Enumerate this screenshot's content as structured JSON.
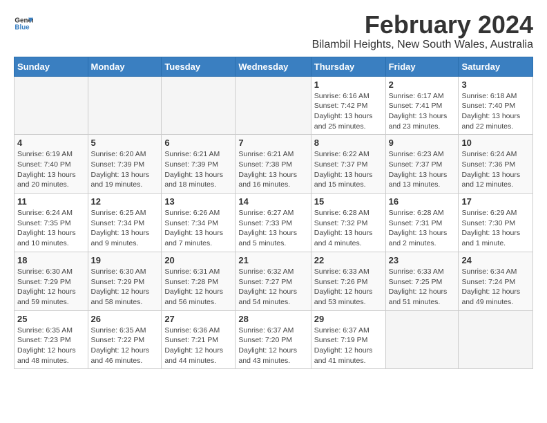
{
  "logo": {
    "text_general": "General",
    "text_blue": "Blue"
  },
  "title": "February 2024",
  "subtitle": "Bilambil Heights, New South Wales, Australia",
  "days_of_week": [
    "Sunday",
    "Monday",
    "Tuesday",
    "Wednesday",
    "Thursday",
    "Friday",
    "Saturday"
  ],
  "weeks": [
    [
      {
        "day": "",
        "info": ""
      },
      {
        "day": "",
        "info": ""
      },
      {
        "day": "",
        "info": ""
      },
      {
        "day": "",
        "info": ""
      },
      {
        "day": "1",
        "info": "Sunrise: 6:16 AM\nSunset: 7:42 PM\nDaylight: 13 hours\nand 25 minutes."
      },
      {
        "day": "2",
        "info": "Sunrise: 6:17 AM\nSunset: 7:41 PM\nDaylight: 13 hours\nand 23 minutes."
      },
      {
        "day": "3",
        "info": "Sunrise: 6:18 AM\nSunset: 7:40 PM\nDaylight: 13 hours\nand 22 minutes."
      }
    ],
    [
      {
        "day": "4",
        "info": "Sunrise: 6:19 AM\nSunset: 7:40 PM\nDaylight: 13 hours\nand 20 minutes."
      },
      {
        "day": "5",
        "info": "Sunrise: 6:20 AM\nSunset: 7:39 PM\nDaylight: 13 hours\nand 19 minutes."
      },
      {
        "day": "6",
        "info": "Sunrise: 6:21 AM\nSunset: 7:39 PM\nDaylight: 13 hours\nand 18 minutes."
      },
      {
        "day": "7",
        "info": "Sunrise: 6:21 AM\nSunset: 7:38 PM\nDaylight: 13 hours\nand 16 minutes."
      },
      {
        "day": "8",
        "info": "Sunrise: 6:22 AM\nSunset: 7:37 PM\nDaylight: 13 hours\nand 15 minutes."
      },
      {
        "day": "9",
        "info": "Sunrise: 6:23 AM\nSunset: 7:37 PM\nDaylight: 13 hours\nand 13 minutes."
      },
      {
        "day": "10",
        "info": "Sunrise: 6:24 AM\nSunset: 7:36 PM\nDaylight: 13 hours\nand 12 minutes."
      }
    ],
    [
      {
        "day": "11",
        "info": "Sunrise: 6:24 AM\nSunset: 7:35 PM\nDaylight: 13 hours\nand 10 minutes."
      },
      {
        "day": "12",
        "info": "Sunrise: 6:25 AM\nSunset: 7:34 PM\nDaylight: 13 hours\nand 9 minutes."
      },
      {
        "day": "13",
        "info": "Sunrise: 6:26 AM\nSunset: 7:34 PM\nDaylight: 13 hours\nand 7 minutes."
      },
      {
        "day": "14",
        "info": "Sunrise: 6:27 AM\nSunset: 7:33 PM\nDaylight: 13 hours\nand 5 minutes."
      },
      {
        "day": "15",
        "info": "Sunrise: 6:28 AM\nSunset: 7:32 PM\nDaylight: 13 hours\nand 4 minutes."
      },
      {
        "day": "16",
        "info": "Sunrise: 6:28 AM\nSunset: 7:31 PM\nDaylight: 13 hours\nand 2 minutes."
      },
      {
        "day": "17",
        "info": "Sunrise: 6:29 AM\nSunset: 7:30 PM\nDaylight: 13 hours\nand 1 minute."
      }
    ],
    [
      {
        "day": "18",
        "info": "Sunrise: 6:30 AM\nSunset: 7:29 PM\nDaylight: 12 hours\nand 59 minutes."
      },
      {
        "day": "19",
        "info": "Sunrise: 6:30 AM\nSunset: 7:29 PM\nDaylight: 12 hours\nand 58 minutes."
      },
      {
        "day": "20",
        "info": "Sunrise: 6:31 AM\nSunset: 7:28 PM\nDaylight: 12 hours\nand 56 minutes."
      },
      {
        "day": "21",
        "info": "Sunrise: 6:32 AM\nSunset: 7:27 PM\nDaylight: 12 hours\nand 54 minutes."
      },
      {
        "day": "22",
        "info": "Sunrise: 6:33 AM\nSunset: 7:26 PM\nDaylight: 12 hours\nand 53 minutes."
      },
      {
        "day": "23",
        "info": "Sunrise: 6:33 AM\nSunset: 7:25 PM\nDaylight: 12 hours\nand 51 minutes."
      },
      {
        "day": "24",
        "info": "Sunrise: 6:34 AM\nSunset: 7:24 PM\nDaylight: 12 hours\nand 49 minutes."
      }
    ],
    [
      {
        "day": "25",
        "info": "Sunrise: 6:35 AM\nSunset: 7:23 PM\nDaylight: 12 hours\nand 48 minutes."
      },
      {
        "day": "26",
        "info": "Sunrise: 6:35 AM\nSunset: 7:22 PM\nDaylight: 12 hours\nand 46 minutes."
      },
      {
        "day": "27",
        "info": "Sunrise: 6:36 AM\nSunset: 7:21 PM\nDaylight: 12 hours\nand 44 minutes."
      },
      {
        "day": "28",
        "info": "Sunrise: 6:37 AM\nSunset: 7:20 PM\nDaylight: 12 hours\nand 43 minutes."
      },
      {
        "day": "29",
        "info": "Sunrise: 6:37 AM\nSunset: 7:19 PM\nDaylight: 12 hours\nand 41 minutes."
      },
      {
        "day": "",
        "info": ""
      },
      {
        "day": "",
        "info": ""
      }
    ]
  ]
}
